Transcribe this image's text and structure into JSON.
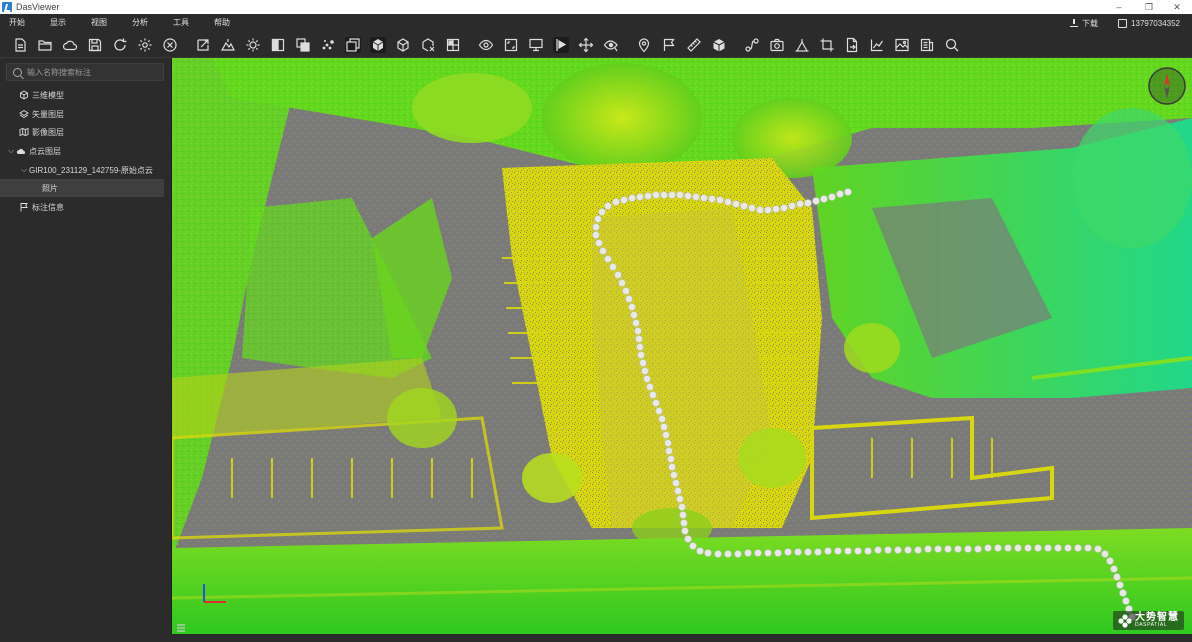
{
  "window": {
    "title": "DasViewer",
    "minimize": "–",
    "maximize": "❐",
    "close": "✕"
  },
  "menubar": {
    "items": [
      "开始",
      "显示",
      "视图",
      "分析",
      "工具",
      "帮助"
    ],
    "download_label": "下载",
    "account": "13797034352"
  },
  "toolbar": {
    "icons": [
      "new-file-icon",
      "open-folder-icon",
      "cloud-icon",
      "save-icon",
      "refresh-icon",
      "settings-icon",
      "close-circle-icon",
      "import-icon",
      "terrain-icon",
      "brightness-icon",
      "split-view-icon",
      "overlay-icon",
      "point-cloud-icon",
      "layers-icon",
      "cube-solid-icon",
      "cube-wire-icon",
      "clip-box-icon",
      "grid-icon",
      "eye-icon",
      "frame-icon",
      "screen-icon",
      "flag-play-icon",
      "move-icon",
      "eye-marker-icon",
      "location-pin-icon",
      "flag-icon",
      "ruler-icon",
      "box-icon",
      "path-icon",
      "camera-icon",
      "height-profile-icon",
      "crop-icon",
      "export-doc-icon",
      "chart-icon",
      "image-icon",
      "report-icon",
      "search-icon"
    ]
  },
  "sidebar": {
    "search_placeholder": "输入名称搜索标注",
    "items": [
      {
        "label": "三维模型",
        "icon": "cube-icon"
      },
      {
        "label": "矢量图层",
        "icon": "vector-layer-icon"
      },
      {
        "label": "影像图层",
        "icon": "map-icon"
      },
      {
        "label": "点云图层",
        "icon": "cloud-icon",
        "expanded": true
      },
      {
        "label": "GIR100_231129_142759-原始点云",
        "icon": "",
        "expanded": true
      },
      {
        "label": "照片",
        "icon": "",
        "selected": true
      },
      {
        "label": "标注信息",
        "icon": "flag-icon"
      }
    ]
  },
  "viewport": {
    "logo_cn": "大势智慧",
    "logo_en": "DASPATIAL",
    "compass": "north-compass-icon"
  },
  "colors": {
    "background": "#2b2b2b",
    "point_yellow": "#e4e00e",
    "point_green": "#5bd81c",
    "ground_gray": "#7d7d7d",
    "trajectory": "#e8e8e8"
  }
}
